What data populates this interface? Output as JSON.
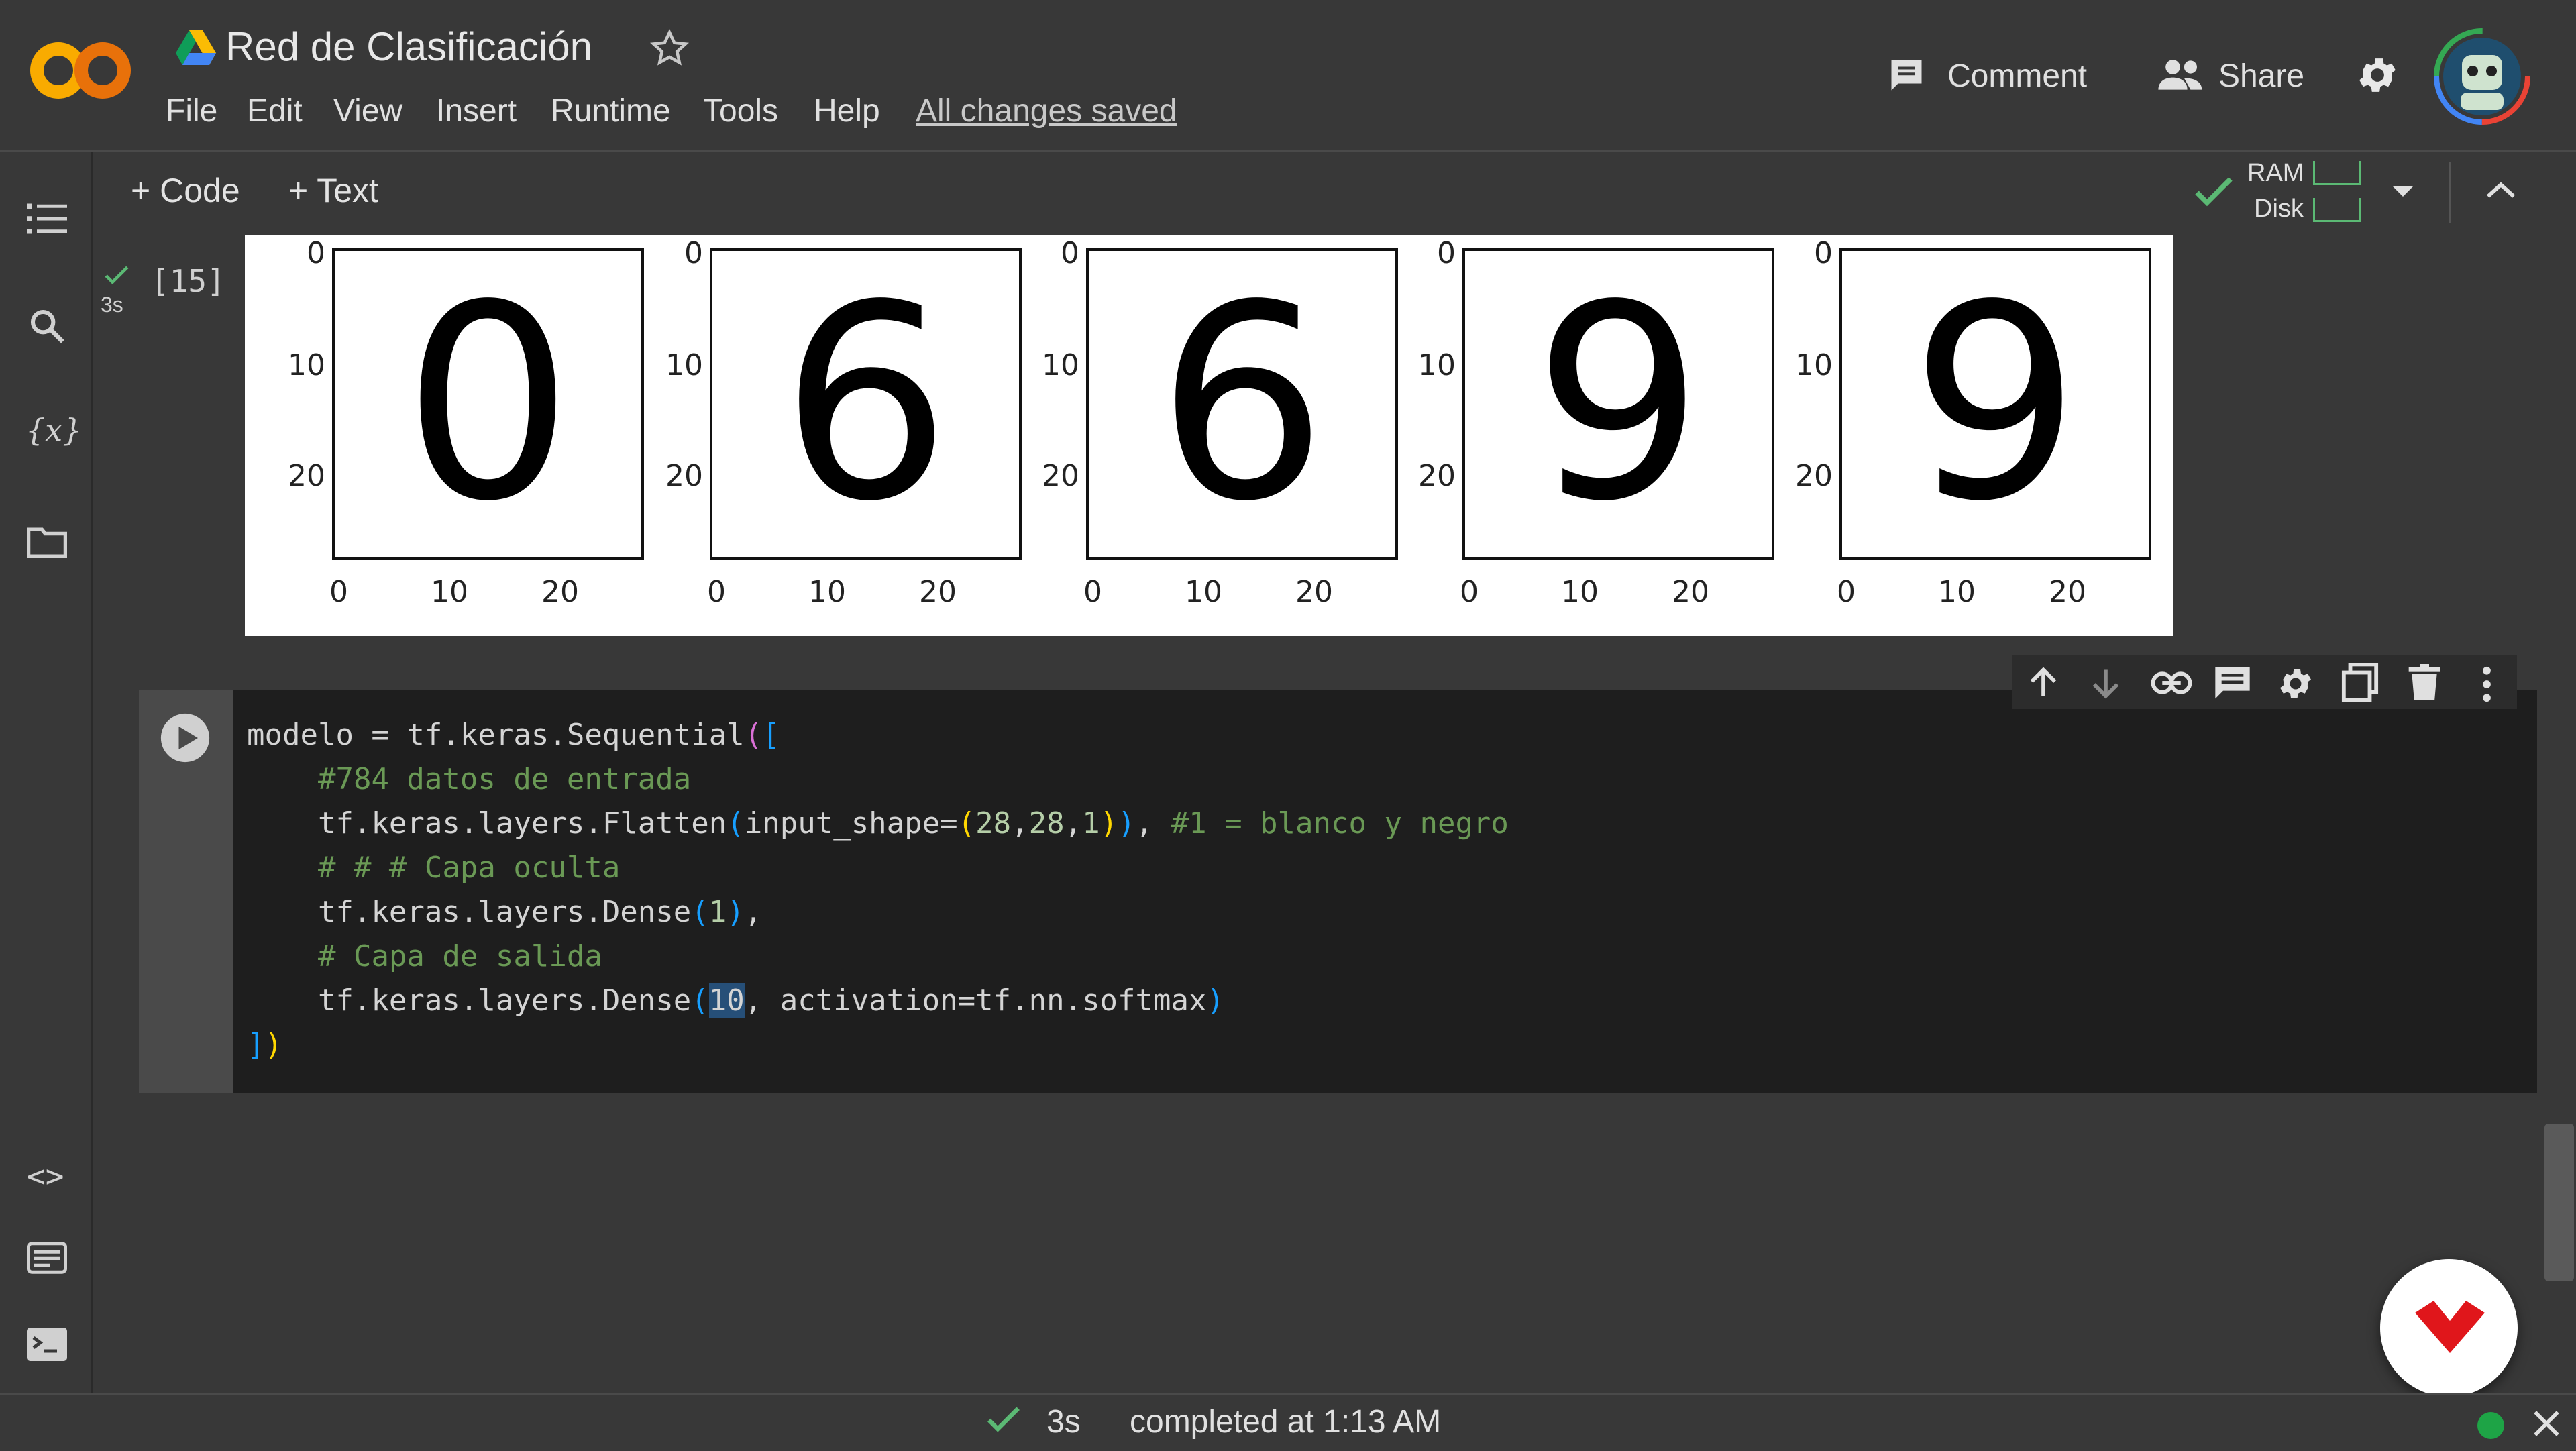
{
  "app": {
    "title": "Red de Clasificación",
    "menu": [
      "File",
      "Edit",
      "View",
      "Insert",
      "Runtime",
      "Tools",
      "Help"
    ],
    "save_status": "All changes saved",
    "comment_label": "Comment",
    "share_label": "Share"
  },
  "toolbar": {
    "code_label": "Code",
    "text_label": "Text",
    "ram_label": "RAM",
    "disk_label": "Disk"
  },
  "output_cell": {
    "exec_count": "[15]",
    "exec_time": "3s",
    "plots": [
      {
        "digit": "0",
        "y_ticks": [
          "0",
          "10",
          "20"
        ],
        "x_ticks": [
          "0",
          "10",
          "20"
        ]
      },
      {
        "digit": "6",
        "y_ticks": [
          "0",
          "10",
          "20"
        ],
        "x_ticks": [
          "0",
          "10",
          "20"
        ]
      },
      {
        "digit": "6",
        "y_ticks": [
          "0",
          "10",
          "20"
        ],
        "x_ticks": [
          "0",
          "10",
          "20"
        ]
      },
      {
        "digit": "9",
        "y_ticks": [
          "0",
          "10",
          "20"
        ],
        "x_ticks": [
          "0",
          "10",
          "20"
        ]
      },
      {
        "digit": "9",
        "y_ticks": [
          "0",
          "10",
          "20"
        ],
        "x_ticks": [
          "0",
          "10",
          "20"
        ]
      }
    ]
  },
  "code_cell": {
    "lines": [
      {
        "indent": "",
        "parts": [
          {
            "t": "modelo = tf.keras.Sequential",
            "c": ""
          },
          {
            "t": "(",
            "c": "p1"
          },
          {
            "t": "[",
            "c": "p2"
          }
        ]
      },
      {
        "indent": "    ",
        "parts": [
          {
            "t": "#784 datos de entrada",
            "c": "cm"
          }
        ]
      },
      {
        "indent": "    ",
        "parts": [
          {
            "t": "tf.keras.layers.Flatten",
            "c": ""
          },
          {
            "t": "(",
            "c": "p2"
          },
          {
            "t": "input_shape=",
            "c": ""
          },
          {
            "t": "(",
            "c": "p3"
          },
          {
            "t": "28",
            "c": "num"
          },
          {
            "t": ",",
            "c": ""
          },
          {
            "t": "28",
            "c": "num"
          },
          {
            "t": ",",
            "c": ""
          },
          {
            "t": "1",
            "c": "num"
          },
          {
            "t": ")",
            "c": "p3"
          },
          {
            "t": ")",
            "c": "p2"
          },
          {
            "t": ", ",
            "c": ""
          },
          {
            "t": "#1 = blanco y negro",
            "c": "cm"
          }
        ]
      },
      {
        "indent": "    ",
        "parts": [
          {
            "t": "# # # Capa oculta",
            "c": "cm"
          }
        ]
      },
      {
        "indent": "    ",
        "parts": [
          {
            "t": "tf.keras.layers.Dense",
            "c": ""
          },
          {
            "t": "(",
            "c": "p2"
          },
          {
            "t": "1",
            "c": "num"
          },
          {
            "t": ")",
            "c": "p2"
          },
          {
            "t": ",",
            "c": ""
          }
        ]
      },
      {
        "indent": "    ",
        "parts": [
          {
            "t": "# Capa de salida",
            "c": "cm"
          }
        ]
      },
      {
        "indent": "    ",
        "parts": [
          {
            "t": "tf.keras.layers.Dense",
            "c": ""
          },
          {
            "t": "(",
            "c": "p2"
          },
          {
            "t": "10",
            "c": "sel"
          },
          {
            "t": ", activation=tf.nn.softmax",
            "c": ""
          },
          {
            "t": ")",
            "c": "p2"
          }
        ]
      },
      {
        "indent": "",
        "parts": [
          {
            "t": "]",
            "c": "p2"
          },
          {
            "t": ")",
            "c": "p3"
          }
        ]
      }
    ]
  },
  "status_bar": {
    "time": "3s",
    "completed": "completed at 1:13 AM"
  },
  "colors": {
    "background": "#383838",
    "editor": "#1e1e1e",
    "accent_green": "#5bb974",
    "logo_orange": "#f9ab00",
    "brand_red": "#e0161b"
  }
}
